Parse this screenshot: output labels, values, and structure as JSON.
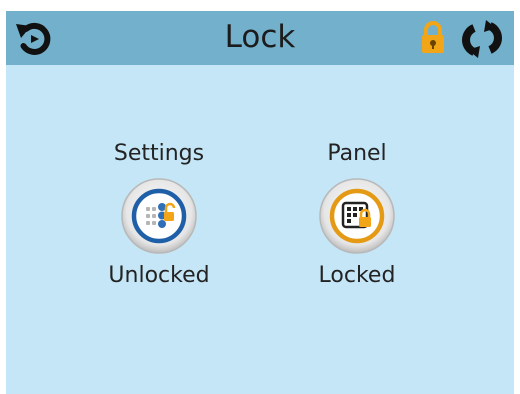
{
  "header": {
    "title": "Lock",
    "back_icon": "back-arrow-icon",
    "status_icon": "padlock-locked-icon",
    "refresh_icon": "refresh-icon",
    "background_color": "#72b0cc"
  },
  "items": [
    {
      "label": "Settings",
      "status": "Unlocked",
      "icon": "settings-unlocked-icon",
      "accent_color": "#1f5fa8"
    },
    {
      "label": "Panel",
      "status": "Locked",
      "icon": "panel-locked-icon",
      "accent_color": "#e59a16"
    }
  ],
  "colors": {
    "screen_background": "#c5e6f6",
    "lock_orange": "#f2a516"
  }
}
